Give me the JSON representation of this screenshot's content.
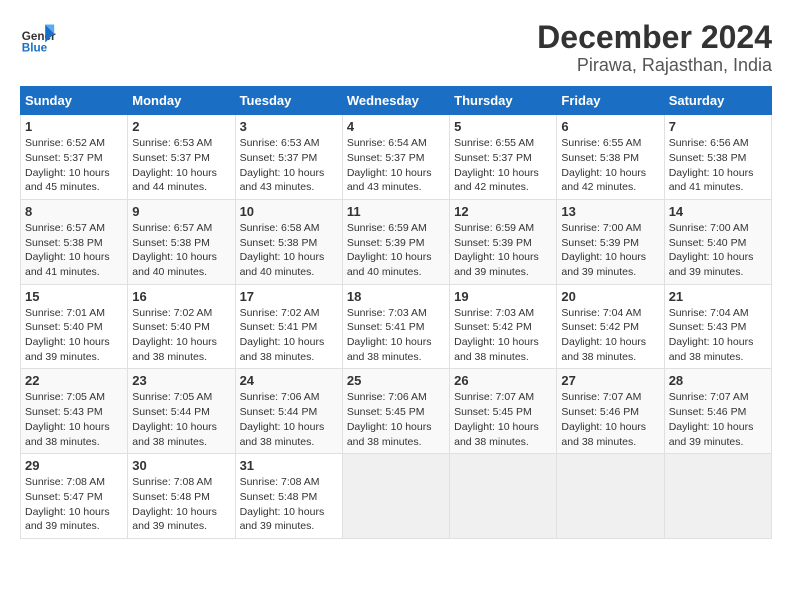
{
  "logo": {
    "line1": "General",
    "line2": "Blue"
  },
  "title": "December 2024",
  "subtitle": "Pirawa, Rajasthan, India",
  "days_of_week": [
    "Sunday",
    "Monday",
    "Tuesday",
    "Wednesday",
    "Thursday",
    "Friday",
    "Saturday"
  ],
  "weeks": [
    [
      {
        "day": 1,
        "info": "Sunrise: 6:52 AM\nSunset: 5:37 PM\nDaylight: 10 hours\nand 45 minutes."
      },
      {
        "day": 2,
        "info": "Sunrise: 6:53 AM\nSunset: 5:37 PM\nDaylight: 10 hours\nand 44 minutes."
      },
      {
        "day": 3,
        "info": "Sunrise: 6:53 AM\nSunset: 5:37 PM\nDaylight: 10 hours\nand 43 minutes."
      },
      {
        "day": 4,
        "info": "Sunrise: 6:54 AM\nSunset: 5:37 PM\nDaylight: 10 hours\nand 43 minutes."
      },
      {
        "day": 5,
        "info": "Sunrise: 6:55 AM\nSunset: 5:37 PM\nDaylight: 10 hours\nand 42 minutes."
      },
      {
        "day": 6,
        "info": "Sunrise: 6:55 AM\nSunset: 5:38 PM\nDaylight: 10 hours\nand 42 minutes."
      },
      {
        "day": 7,
        "info": "Sunrise: 6:56 AM\nSunset: 5:38 PM\nDaylight: 10 hours\nand 41 minutes."
      }
    ],
    [
      {
        "day": 8,
        "info": "Sunrise: 6:57 AM\nSunset: 5:38 PM\nDaylight: 10 hours\nand 41 minutes."
      },
      {
        "day": 9,
        "info": "Sunrise: 6:57 AM\nSunset: 5:38 PM\nDaylight: 10 hours\nand 40 minutes."
      },
      {
        "day": 10,
        "info": "Sunrise: 6:58 AM\nSunset: 5:38 PM\nDaylight: 10 hours\nand 40 minutes."
      },
      {
        "day": 11,
        "info": "Sunrise: 6:59 AM\nSunset: 5:39 PM\nDaylight: 10 hours\nand 40 minutes."
      },
      {
        "day": 12,
        "info": "Sunrise: 6:59 AM\nSunset: 5:39 PM\nDaylight: 10 hours\nand 39 minutes."
      },
      {
        "day": 13,
        "info": "Sunrise: 7:00 AM\nSunset: 5:39 PM\nDaylight: 10 hours\nand 39 minutes."
      },
      {
        "day": 14,
        "info": "Sunrise: 7:00 AM\nSunset: 5:40 PM\nDaylight: 10 hours\nand 39 minutes."
      }
    ],
    [
      {
        "day": 15,
        "info": "Sunrise: 7:01 AM\nSunset: 5:40 PM\nDaylight: 10 hours\nand 39 minutes."
      },
      {
        "day": 16,
        "info": "Sunrise: 7:02 AM\nSunset: 5:40 PM\nDaylight: 10 hours\nand 38 minutes."
      },
      {
        "day": 17,
        "info": "Sunrise: 7:02 AM\nSunset: 5:41 PM\nDaylight: 10 hours\nand 38 minutes."
      },
      {
        "day": 18,
        "info": "Sunrise: 7:03 AM\nSunset: 5:41 PM\nDaylight: 10 hours\nand 38 minutes."
      },
      {
        "day": 19,
        "info": "Sunrise: 7:03 AM\nSunset: 5:42 PM\nDaylight: 10 hours\nand 38 minutes."
      },
      {
        "day": 20,
        "info": "Sunrise: 7:04 AM\nSunset: 5:42 PM\nDaylight: 10 hours\nand 38 minutes."
      },
      {
        "day": 21,
        "info": "Sunrise: 7:04 AM\nSunset: 5:43 PM\nDaylight: 10 hours\nand 38 minutes."
      }
    ],
    [
      {
        "day": 22,
        "info": "Sunrise: 7:05 AM\nSunset: 5:43 PM\nDaylight: 10 hours\nand 38 minutes."
      },
      {
        "day": 23,
        "info": "Sunrise: 7:05 AM\nSunset: 5:44 PM\nDaylight: 10 hours\nand 38 minutes."
      },
      {
        "day": 24,
        "info": "Sunrise: 7:06 AM\nSunset: 5:44 PM\nDaylight: 10 hours\nand 38 minutes."
      },
      {
        "day": 25,
        "info": "Sunrise: 7:06 AM\nSunset: 5:45 PM\nDaylight: 10 hours\nand 38 minutes."
      },
      {
        "day": 26,
        "info": "Sunrise: 7:07 AM\nSunset: 5:45 PM\nDaylight: 10 hours\nand 38 minutes."
      },
      {
        "day": 27,
        "info": "Sunrise: 7:07 AM\nSunset: 5:46 PM\nDaylight: 10 hours\nand 38 minutes."
      },
      {
        "day": 28,
        "info": "Sunrise: 7:07 AM\nSunset: 5:46 PM\nDaylight: 10 hours\nand 39 minutes."
      }
    ],
    [
      {
        "day": 29,
        "info": "Sunrise: 7:08 AM\nSunset: 5:47 PM\nDaylight: 10 hours\nand 39 minutes."
      },
      {
        "day": 30,
        "info": "Sunrise: 7:08 AM\nSunset: 5:48 PM\nDaylight: 10 hours\nand 39 minutes."
      },
      {
        "day": 31,
        "info": "Sunrise: 7:08 AM\nSunset: 5:48 PM\nDaylight: 10 hours\nand 39 minutes."
      },
      null,
      null,
      null,
      null
    ]
  ]
}
